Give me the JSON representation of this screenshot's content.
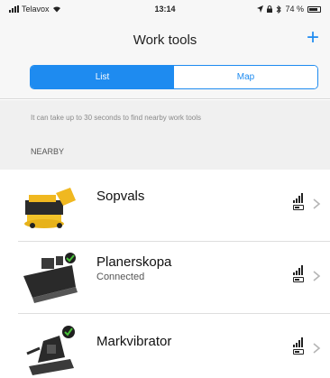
{
  "status_bar": {
    "carrier": "Telavox",
    "time": "13:14",
    "battery_text": "74 %",
    "icons": [
      "signal-icon",
      "wifi-icon",
      "location-icon",
      "lock-icon",
      "bluetooth-icon",
      "battery-icon"
    ]
  },
  "nav": {
    "title": "Work tools",
    "add_icon": "plus-icon",
    "add_symbol": "+",
    "accent_color": "#1e8bf0"
  },
  "segment": {
    "options": [
      "List",
      "Map"
    ],
    "selected": "List"
  },
  "info": {
    "message": "It can take up to 30 seconds to find nearby work tools",
    "section_title": "NEARBY"
  },
  "tools": [
    {
      "name": "Sopvals",
      "status": "",
      "image_icon": "sweeper-attachment-icon",
      "connected_badge": false
    },
    {
      "name": "Planerskopa",
      "status": "Connected",
      "image_icon": "grading-bucket-icon",
      "connected_badge": true
    },
    {
      "name": "Markvibrator",
      "status": "",
      "image_icon": "plate-compactor-icon",
      "connected_badge": true
    }
  ]
}
